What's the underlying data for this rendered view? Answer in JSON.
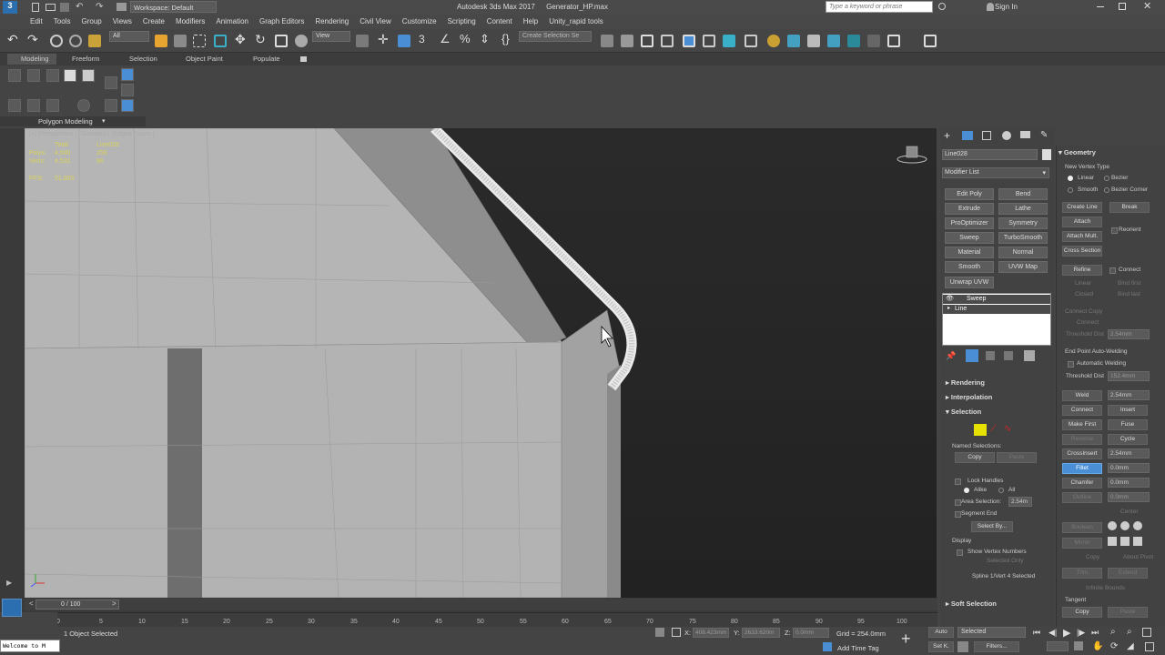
{
  "title_bar": {
    "workspace": "Workspace: Default",
    "app_title": "Autodesk 3ds Max 2017",
    "file_name": "Generator_HP.max",
    "search_placeholder": "Type a keyword or phrase",
    "sign_in": "Sign In"
  },
  "menu": [
    "Edit",
    "Tools",
    "Group",
    "Views",
    "Create",
    "Modifiers",
    "Animation",
    "Graph Editors",
    "Rendering",
    "Civil View",
    "Customize",
    "Scripting",
    "Content",
    "Help",
    "Unity_rapid tools"
  ],
  "toolbar": {
    "filter_value": "All",
    "view_value": "View",
    "selection_set_placeholder": "Create Selection Se"
  },
  "ribbon": {
    "tabs": [
      "Modeling",
      "Freeform",
      "Selection",
      "Object Paint",
      "Populate"
    ],
    "panel_label": "Polygon Modeling"
  },
  "viewport": {
    "label": "[+] [Perspective ] [Standard ] [Edged Faces ]",
    "stats_header": [
      "Total",
      "Line028"
    ],
    "stats_rows": [
      {
        "label": "Polys:",
        "total": "4,040",
        "sel": "256"
      },
      {
        "label": "Verts:",
        "total": "4,532",
        "sel": "96"
      }
    ],
    "fps_label": "FPS:",
    "fps_value": "51.800"
  },
  "command_panel": {
    "object_name": "Line028",
    "modifier_list": "Modifier List",
    "modifier_buttons": [
      [
        "Edit Poly",
        "Bend"
      ],
      [
        "Extrude",
        "Lathe"
      ],
      [
        "ProOptimizer",
        "Symmetry"
      ],
      [
        "Sweep",
        "TurboSmooth"
      ],
      [
        "Material",
        "Normal"
      ],
      [
        "Smooth",
        "UVW Map"
      ]
    ],
    "extra_button": "Unwrap UVW",
    "stack": [
      "Sweep",
      "Line"
    ],
    "rollouts": {
      "rendering": "Rendering",
      "interpolation": "Interpolation",
      "selection": "Selection",
      "soft_selection": "Soft Selection"
    },
    "named_selections": "Named Selections:",
    "copy": "Copy",
    "paste": "Paste",
    "lock_handles": "Lock Handles",
    "alike": "Alike",
    "all": "All",
    "area_selection": "Area Selection:",
    "area_value": "2.54m",
    "segment_end": "Segment End",
    "select_by": "Select By...",
    "display": "Display",
    "show_vertex_numbers": "Show Vertex Numbers",
    "selected_only": "Selected Only",
    "status": "Spline 1/Vert 4 Selected"
  },
  "geometry_panel": {
    "title": "Geometry",
    "new_vertex_type": "New Vertex Type",
    "linear": "Linear",
    "bezier": "Bezier",
    "smooth": "Smooth",
    "bezier_corner": "Bezier Corner",
    "create_line": "Create Line",
    "break": "Break",
    "attach": "Attach",
    "reorient": "Reorient",
    "attach_mult": "Attach Mult.",
    "cross_section": "Cross Section",
    "refine": "Refine",
    "connect": "Connect",
    "linear2": "Linear",
    "bind_first": "Bind first",
    "closed": "Closed",
    "bind_last": "Bind last",
    "connect_copy": "Connect Copy",
    "connect2": "Connect",
    "threshold_dist": "Threshold Dist",
    "threshold_value": "2.54mm",
    "end_point": "End Point Auto-Welding",
    "automatic_welding": "Automatic Welding",
    "threshold_dist2": "Threshold Dist",
    "threshold_value2": "152.4mm",
    "weld": "Weld",
    "weld_value": "2.54mm",
    "connect3": "Connect",
    "insert": "Insert",
    "make_first": "Make First",
    "fuse": "Fuse",
    "reverse": "Reverse",
    "cycle": "Cycle",
    "crossinsert": "CrossInsert",
    "crossinsert_value": "2.54mm",
    "fillet": "Fillet",
    "fillet_value": "0.0mm",
    "chamfer": "Chamfer",
    "chamfer_value": "0.0mm",
    "outline": "Outline",
    "outline_value": "0.0mm",
    "center": "Center",
    "boolean": "Boolean",
    "mirror": "Mirror",
    "copy": "Copy",
    "about_pivot": "About Pivot",
    "trim": "Trim",
    "extend": "Extend",
    "infinite_bounds": "Infinite Bounds",
    "tangent": "Tangent",
    "copy2": "Copy",
    "paste": "Paste"
  },
  "timeline": {
    "frame": "0 / 100",
    "ticks": [
      "0",
      "5",
      "10",
      "15",
      "20",
      "25",
      "30",
      "35",
      "40",
      "45",
      "50",
      "55",
      "60",
      "65",
      "70",
      "75",
      "80",
      "85",
      "90",
      "95",
      "100"
    ]
  },
  "status": {
    "maxscript": "Welcome to M",
    "selection_info": "1 Object Selected",
    "x_value": "408.423mm",
    "y_value": "2633.620m",
    "z_value": "0.0mm",
    "grid": "Grid = 254.0mm",
    "add_time_tag": "Add Time Tag",
    "auto": "Auto",
    "selected": "Selected",
    "set_k": "Set K.",
    "filters": "Filters..."
  },
  "colors": {
    "accent_blue": "#4a8fd6",
    "stats_yellow": "#d7d35a",
    "panel_bg": "#424242",
    "viewport_bg": "#262626"
  }
}
